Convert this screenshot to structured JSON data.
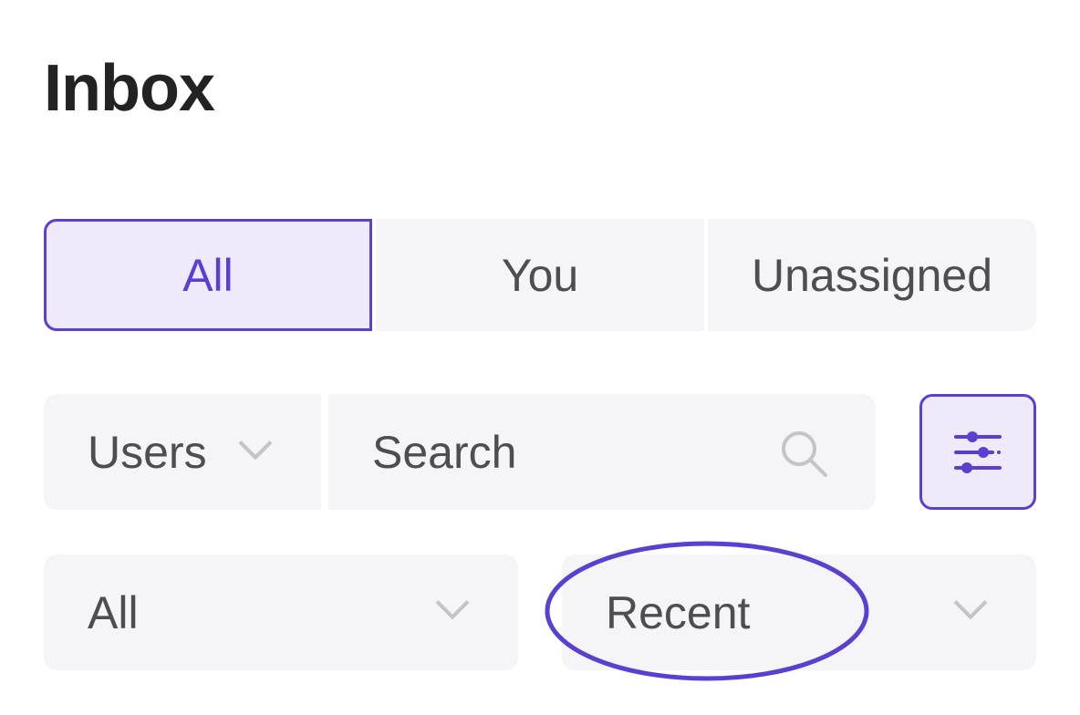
{
  "header": {
    "title": "Inbox"
  },
  "tabs": [
    {
      "label": "All",
      "active": true
    },
    {
      "label": "You",
      "active": false
    },
    {
      "label": "Unassigned",
      "active": false
    }
  ],
  "filters": {
    "users_select": {
      "label": "Users"
    },
    "search": {
      "placeholder": "Search",
      "value": ""
    },
    "status_select": {
      "label": "All"
    },
    "sort_select": {
      "label": "Recent"
    }
  },
  "icons": {
    "search": "search-icon",
    "filter": "sliders-icon",
    "dropdown": "chevron-down-icon"
  },
  "colors": {
    "accent": "#5b3fd3",
    "accent_bg": "#eeeafc",
    "surface": "#f5f5f7",
    "text": "#4d4d52",
    "title": "#232323"
  }
}
